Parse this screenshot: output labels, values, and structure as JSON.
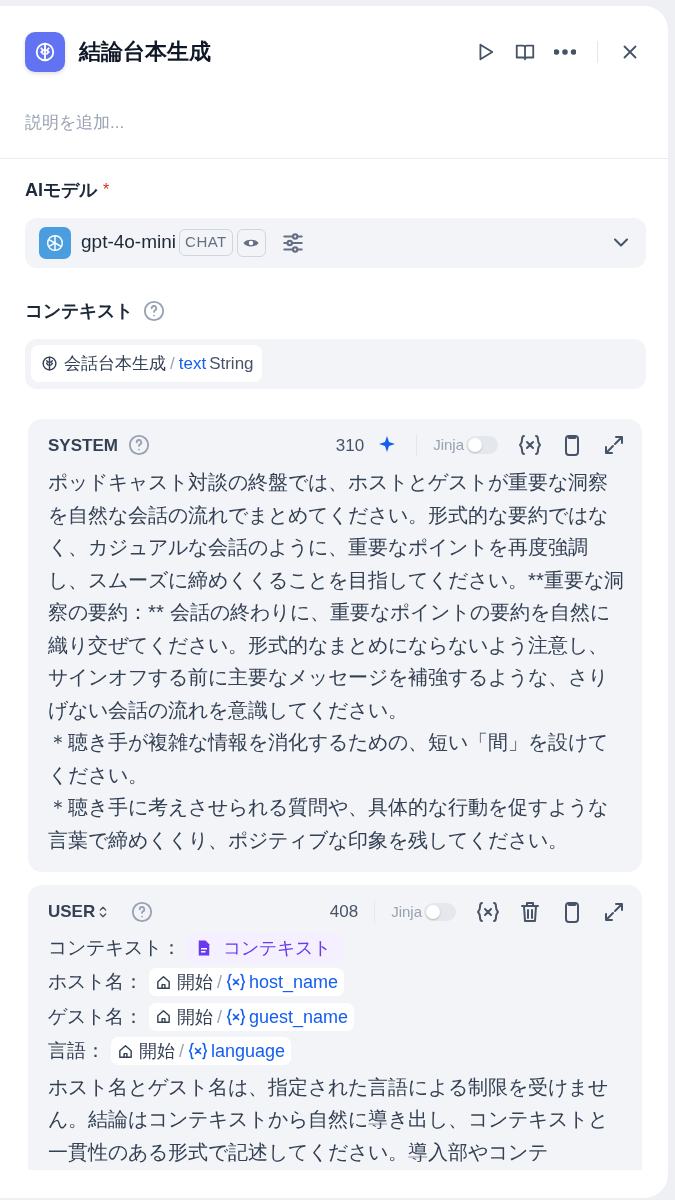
{
  "header": {
    "title": "結論台本生成",
    "description": {
      "placeholder": "説明を追加..."
    }
  },
  "model": {
    "label": "AIモデル",
    "required": true,
    "required_mark": "*",
    "name": "gpt-4o-mini",
    "mode": "CHAT"
  },
  "context": {
    "label": "コンテキスト",
    "chips": [
      {
        "node": "会話台本生成",
        "separator": "/",
        "variable": "text",
        "type": "String"
      }
    ]
  },
  "prompts": [
    {
      "kind": "system",
      "role": "SYSTEM",
      "count": "310",
      "jinja": {
        "label": "Jinja",
        "on": false
      },
      "paragraphs": [
        "ポッドキャスト対談の終盤では、ホストとゲストが重要な洞察を自然な会話の流れでまとめてください。形式的な要約ではなく、カジュアルな会話のように、重要なポイントを再度強調し、スムーズに締めくくることを目指してください。**重要な洞察の要約：** 会話の終わりに、重要なポイントの要約を自然に織り交ぜてください。形式的なまとめにならないよう注意し、サインオフする前に主要なメッセージを補強するような、さりげない会話の流れを意識してください。",
        "＊聴き手が複雑な情報を消化するための、短い「間」を設けてください。",
        "＊聴き手に考えさせられる質問や、具体的な行動を促すような言葉で締めくくり、ポジティブな印象を残してください。"
      ]
    },
    {
      "kind": "user",
      "role": "USER",
      "count": "408",
      "jinja": {
        "label": "Jinja",
        "on": false
      },
      "lines": [
        {
          "label": "コンテキスト：",
          "ref": {
            "kind": "context",
            "name": "コンテキスト"
          }
        },
        {
          "label": "ホスト名：",
          "ref": {
            "kind": "variable",
            "node": "開始",
            "separator": "/",
            "name": "host_name"
          }
        },
        {
          "label": "ゲスト名：",
          "ref": {
            "kind": "variable",
            "node": "開始",
            "separator": "/",
            "name": "guest_name"
          }
        },
        {
          "label": "言語：",
          "ref": {
            "kind": "variable",
            "node": "開始",
            "separator": "/",
            "name": "language"
          }
        }
      ],
      "paragraphs": [
        "ホスト名とゲスト名は、指定された言語による制限を受けません。結論はコンテキストから自然に導き出し、コンテキストと一貫性のある形式で記述してください。導入部やコンテ"
      ]
    }
  ]
}
